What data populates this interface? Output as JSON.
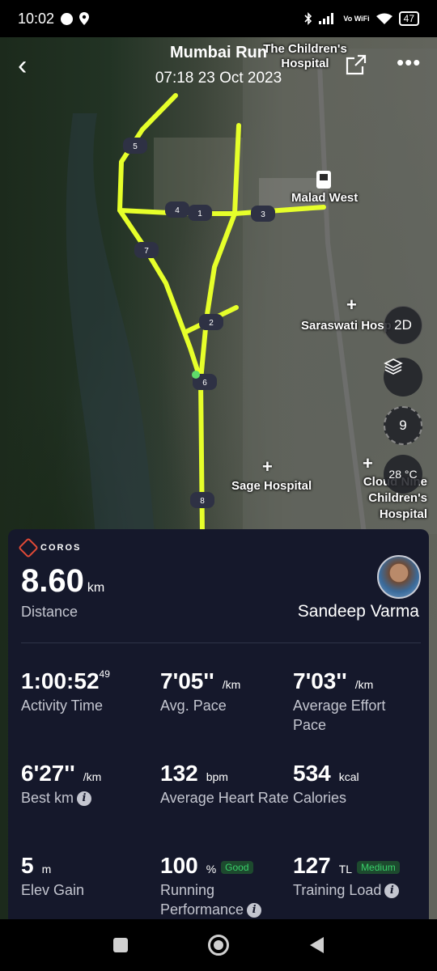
{
  "status": {
    "time": "10:02",
    "battery": "47",
    "network": "Vo WiFi"
  },
  "header": {
    "title": "Mumbai Run",
    "datetime": "07:18 23 Oct 2023"
  },
  "map": {
    "labels": {
      "childrens_hospital": "The Children's Hospital",
      "malad_west": "Malad West",
      "saraswati": "Saraswati Hosp",
      "sage": "Sage Hospital",
      "cloud_nine": "Cloud Nine Children's Hospital"
    },
    "markers": [
      "1",
      "2",
      "3",
      "4",
      "5",
      "6",
      "7",
      "8"
    ],
    "view_mode": "2D",
    "compass_value": "9",
    "temperature": "28 °C",
    "route_color": "#e6ff2a"
  },
  "card": {
    "brand": "COROS",
    "distance_value": "8.60",
    "distance_unit": "km",
    "distance_label": "Distance",
    "user_name": "Sandeep Varma",
    "stats": {
      "activity_time": {
        "value": "1:00:52",
        "fraction": "49",
        "label": "Activity Time"
      },
      "avg_pace": {
        "value": "7'05''",
        "unit": "/km",
        "label": "Avg. Pace"
      },
      "effort_pace": {
        "value": "7'03''",
        "unit": "/km",
        "label": "Average Effort Pace"
      },
      "best_km": {
        "value": "6'27''",
        "unit": "/km",
        "label": "Best km"
      },
      "heart_rate": {
        "value": "132",
        "unit": "bpm",
        "label": "Average Heart Rate"
      },
      "calories": {
        "value": "534",
        "unit": "kcal",
        "label": "Calories"
      },
      "elev_gain": {
        "value": "5",
        "unit": "m",
        "label": "Elev Gain"
      },
      "running_perf": {
        "value": "100",
        "unit": "%",
        "badge": "Good",
        "label": "Running Performance"
      },
      "training_load": {
        "value": "127",
        "unit": "TL",
        "badge": "Medium",
        "label": "Training Load"
      }
    }
  }
}
